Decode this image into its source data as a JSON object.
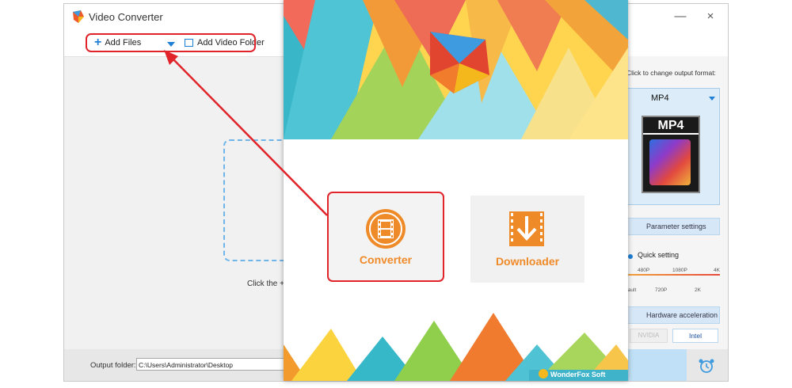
{
  "window": {
    "title": "Video Converter",
    "minimize_glyph": "—",
    "close_glyph": "×"
  },
  "toolbar": {
    "add_files_label": "Add Files",
    "add_folder_label": "Add Video Folder"
  },
  "main": {
    "drop_hint": "Click the +"
  },
  "output": {
    "label": "Output folder:",
    "path": "C:\\Users\\Administrator\\Desktop"
  },
  "right_panel": {
    "format_hint": "Click to change output format:",
    "format_name": "MP4",
    "format_thumb_label": "MP4",
    "parameter_settings": "Parameter settings",
    "quick_setting": "Quick setting",
    "quick_ticks_top": [
      "480P",
      "1080P",
      "4K"
    ],
    "quick_ticks_bottom": [
      "fault",
      "720P",
      "2K"
    ],
    "hardware_acceleration": "Hardware acceleration",
    "gpu_nvidia": "NVIDIA",
    "gpu_intel": "Intel"
  },
  "splash": {
    "converter_label": "Converter",
    "downloader_label": "Downloader",
    "brand": "WonderFox Soft"
  },
  "icons": {
    "app_logo": "app-logo-icon",
    "converter": "film-reel-icon",
    "downloader": "download-arrow-icon",
    "alarm": "alarm-clock-icon"
  },
  "colors": {
    "accent_orange": "#ef8a28",
    "annotation_red": "#e0242a",
    "accent_blue": "#1f7fd6"
  }
}
